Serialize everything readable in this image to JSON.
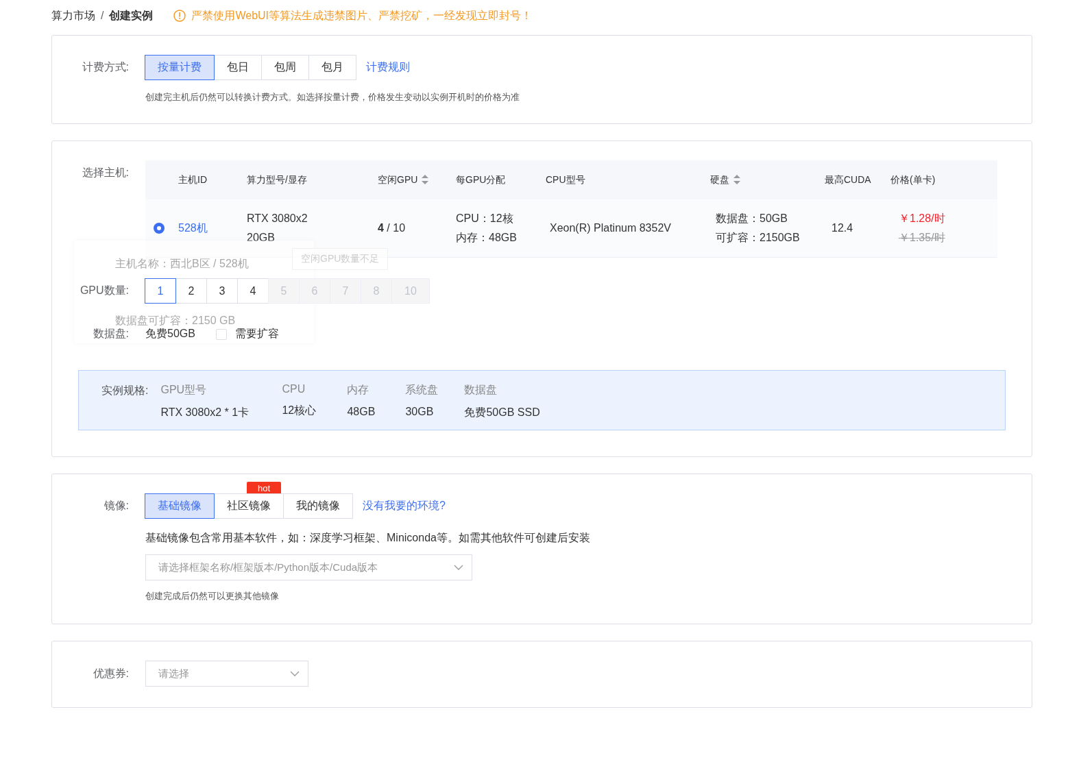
{
  "breadcrumb": [
    {
      "label": "算力市场",
      "current": false
    },
    {
      "label": "创建实例",
      "current": true
    }
  ],
  "breadcrumb_separator": "/",
  "warning": "严禁使用WebUI等算法生成违禁图片、严禁挖矿，一经发现立即封号！",
  "billing": {
    "label": "计费方式:",
    "options": [
      {
        "label": "按量计费",
        "selected": true
      },
      {
        "label": "包日",
        "selected": false
      },
      {
        "label": "包周",
        "selected": false
      },
      {
        "label": "包月",
        "selected": false
      }
    ],
    "link": "计费规则",
    "hint": "创建完主机后仍然可以转换计费方式。如选择按量计费，价格发生变动以实例开机时的价格为准"
  },
  "host": {
    "label": "选择主机:",
    "columns": [
      {
        "label": "主机ID",
        "sortable": false
      },
      {
        "label": "算力型号/显存",
        "sortable": false
      },
      {
        "label": "空闲GPU",
        "sortable": true
      },
      {
        "label": "每GPU分配",
        "sortable": false
      },
      {
        "label": "CPU型号",
        "sortable": false
      },
      {
        "label": "硬盘",
        "sortable": true
      },
      {
        "label": "最高CUDA",
        "sortable": false
      },
      {
        "label": "价格(单卡)",
        "sortable": false
      }
    ],
    "rows": [
      {
        "selected": true,
        "id": "528机",
        "model": "RTX 3080x2",
        "vram": "20GB",
        "free_gpu": "**4** / 10",
        "cpu": "CPU：12核",
        "mem": "内存：48GB",
        "cpu_model": "Xeon(R) Platinum 8352V",
        "disk": "数据盘：50GB",
        "disk_ext": "可扩容：2150GB",
        "cuda": "12.4",
        "price": "￥1.28/时",
        "old_price": "￥1.35/时"
      }
    ],
    "tooltip": "空闲GPU数量不足",
    "popup": [
      "主机名称：西北B区 / 528机",
      "数据盘可扩容：2150 GB"
    ]
  },
  "gpu_count": {
    "label": "GPU数量:",
    "options": [
      {
        "label": "1",
        "selected": true,
        "disabled": false
      },
      {
        "label": "2",
        "selected": false,
        "disabled": false
      },
      {
        "label": "3",
        "selected": false,
        "disabled": false
      },
      {
        "label": "4",
        "selected": false,
        "disabled": false
      },
      {
        "label": "5",
        "selected": false,
        "disabled": true
      },
      {
        "label": "6",
        "selected": false,
        "disabled": true
      },
      {
        "label": "7",
        "selected": false,
        "disabled": true
      },
      {
        "label": "8",
        "selected": false,
        "disabled": true
      },
      {
        "label": "10",
        "selected": false,
        "disabled": true
      }
    ]
  },
  "data_disk": {
    "label": "数据盘:",
    "value": "免费50GB",
    "expand_label": "需要扩容",
    "checked": false
  },
  "spec": {
    "label": "实例规格:",
    "items": [
      {
        "name": "GPU型号",
        "value": "RTX 3080x2 * 1卡"
      },
      {
        "name": "CPU",
        "value": "12核心"
      },
      {
        "name": "内存",
        "value": "48GB"
      },
      {
        "name": "系统盘",
        "value": "30GB"
      },
      {
        "name": "数据盘",
        "value": "免费50GB SSD"
      }
    ]
  },
  "image": {
    "label": "镜像:",
    "tabs": [
      {
        "label": "基础镜像",
        "selected": true
      },
      {
        "label": "社区镜像",
        "selected": false,
        "badge": "hot"
      },
      {
        "label": "我的镜像",
        "selected": false
      }
    ],
    "link": "没有我要的环境?",
    "desc": "基础镜像包含常用基本软件，如：深度学习框架、Miniconda等。如需其他软件可创建后安装",
    "placeholder": "请选择框架名称/框架版本/Python版本/Cuda版本",
    "hint": "创建完成后仍然可以更换其他镜像"
  },
  "coupon": {
    "label": "优惠券:",
    "placeholder": "请选择"
  }
}
